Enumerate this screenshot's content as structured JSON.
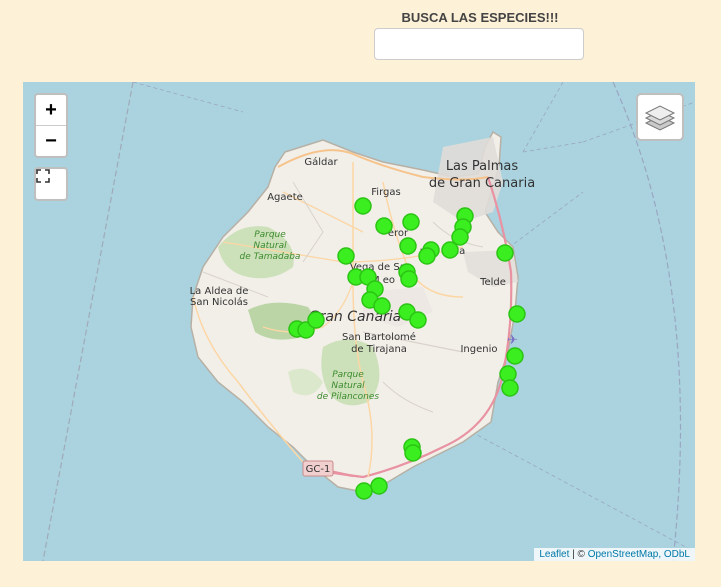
{
  "search": {
    "title": "BUSCA LAS ESPECIES!!!",
    "value": ""
  },
  "map": {
    "zoom_in": "+",
    "zoom_out": "−",
    "fullscreen_icon": "fullscreen-icon",
    "layers_icon": "layers-icon",
    "attribution": {
      "leaflet": "Leaflet",
      "sep": " | © ",
      "osm": "OpenStreetMap, ODbL"
    },
    "labels": {
      "las_palmas_1": "Las Palmas",
      "las_palmas_2": "de Gran Canaria",
      "galdar": "Gáldar",
      "agaete": "Agaete",
      "firgas": "Firgas",
      "teror": "eror",
      "santa_brigida": "nta",
      "brigida_end": "da",
      "vega_1": "Vega de San",
      "vega_2": "M    eo",
      "telde": "Telde",
      "tamadaba_1": "Parque",
      "tamadaba_2": "Natural",
      "tamadaba_3": "de Tamadaba",
      "aldea_1": "La Aldea de",
      "aldea_2": "San Nicolás",
      "gran_canaria": "Gran Canaria",
      "tirajana_1": "San Bartolomé",
      "tirajana_2": "de Tirajana",
      "ingenio": "Ingenio",
      "pilancones_1": "Parque",
      "pilancones_2": "Natural",
      "pilancones_3": "de Pilancones",
      "road": "GC-1"
    },
    "colors": {
      "sea": "#aad3df",
      "land": "#f2efe9",
      "marker": "#3aee20",
      "marker_stroke": "#2bc414"
    }
  }
}
